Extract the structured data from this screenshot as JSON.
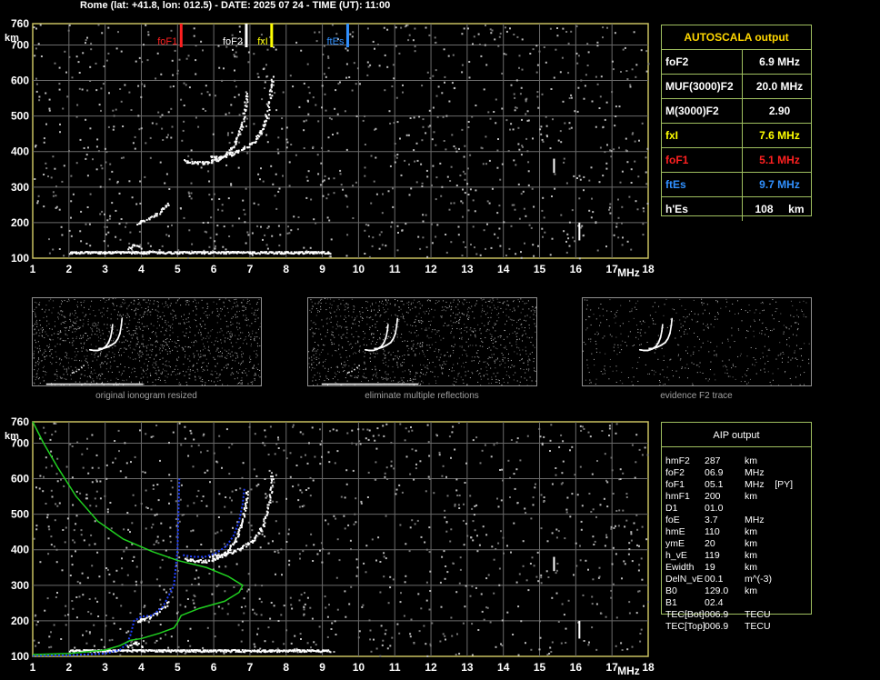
{
  "header": {
    "title": "Rome (lat: +41.8, lon: 012.5) - DATE: 2025 07 24 - TIME (UT): 11:00"
  },
  "chart_data": [
    {
      "type": "scatter",
      "name": "upper-ionogram",
      "ylabel": "km",
      "xlabel": "MHz",
      "xlim": [
        1,
        18
      ],
      "ylim": [
        100,
        760
      ],
      "x_ticks": [
        "1",
        "2",
        "3",
        "4",
        "5",
        "6",
        "7",
        "8",
        "9",
        "10",
        "11",
        "12",
        "13",
        "14",
        "15",
        "16",
        "17",
        "18"
      ],
      "y_ticks": [
        "100",
        "200",
        "300",
        "400",
        "500",
        "600",
        "700",
        "760"
      ],
      "markers": [
        {
          "label": "foF1",
          "freq": 5.1,
          "color": "#ff2020"
        },
        {
          "label": "foF2",
          "freq": 6.9,
          "color": "#ffffff"
        },
        {
          "label": "fxI",
          "freq": 7.6,
          "color": "#ffff00"
        },
        {
          "label": "ftEs",
          "freq": 9.7,
          "color": "#3090ff"
        }
      ],
      "traces": {
        "es_trace": {
          "x": [
            2.0,
            9.2
          ],
          "h": 115
        },
        "e_bump": [
          [
            3.6,
            128
          ],
          [
            3.8,
            140
          ],
          [
            4.0,
            132
          ]
        ],
        "low_f_trace": [
          [
            3.9,
            200
          ],
          [
            4.0,
            205
          ],
          [
            4.2,
            212
          ],
          [
            4.4,
            225
          ],
          [
            4.6,
            240
          ],
          [
            4.75,
            255
          ]
        ],
        "o_trace": [
          [
            5.2,
            375
          ],
          [
            5.5,
            370
          ],
          [
            5.8,
            370
          ],
          [
            6.1,
            380
          ],
          [
            6.4,
            400
          ],
          [
            6.6,
            430
          ],
          [
            6.75,
            470
          ],
          [
            6.85,
            520
          ],
          [
            6.9,
            565
          ]
        ],
        "x_trace": [
          [
            5.9,
            385
          ],
          [
            6.2,
            385
          ],
          [
            6.5,
            395
          ],
          [
            6.8,
            410
          ],
          [
            7.1,
            430
          ],
          [
            7.3,
            460
          ],
          [
            7.45,
            500
          ],
          [
            7.55,
            560
          ],
          [
            7.6,
            610
          ]
        ]
      }
    },
    {
      "type": "line",
      "name": "lower-ionogram",
      "ylabel": "km",
      "xlabel": "MHz",
      "xlim": [
        1,
        18
      ],
      "ylim": [
        100,
        760
      ],
      "x_ticks": [
        "1",
        "2",
        "3",
        "4",
        "5",
        "6",
        "7",
        "8",
        "9",
        "10",
        "11",
        "12",
        "13",
        "14",
        "15",
        "16",
        "17",
        "18"
      ],
      "y_ticks": [
        "100",
        "200",
        "300",
        "400",
        "500",
        "600",
        "700",
        "760"
      ],
      "profile_true_height": [
        [
          1.0,
          760
        ],
        [
          1.3,
          700
        ],
        [
          1.7,
          630
        ],
        [
          2.2,
          550
        ],
        [
          2.8,
          480
        ],
        [
          3.5,
          430
        ],
        [
          4.3,
          395
        ],
        [
          5.0,
          370
        ],
        [
          5.8,
          350
        ],
        [
          6.4,
          325
        ],
        [
          6.8,
          300
        ],
        [
          6.7,
          280
        ],
        [
          6.3,
          255
        ],
        [
          5.6,
          235
        ],
        [
          5.1,
          215
        ],
        [
          5.0,
          195
        ],
        [
          4.9,
          180
        ],
        [
          4.5,
          165
        ],
        [
          4.0,
          150
        ],
        [
          3.7,
          145
        ],
        [
          3.4,
          130
        ],
        [
          3.0,
          118
        ],
        [
          2.0,
          108
        ],
        [
          1.0,
          105
        ]
      ],
      "profile_virtual_height": [
        [
          1.0,
          102
        ],
        [
          2.0,
          103
        ],
        [
          3.0,
          108
        ],
        [
          3.4,
          118
        ],
        [
          3.6,
          135
        ],
        [
          3.7,
          160
        ],
        [
          3.8,
          200
        ],
        [
          4.0,
          212
        ],
        [
          4.3,
          215
        ],
        [
          4.6,
          240
        ],
        [
          4.9,
          300
        ],
        [
          5.0,
          400
        ],
        [
          5.05,
          600
        ]
      ]
    }
  ],
  "autoscala": {
    "title": "AUTOSCALA output",
    "rows": [
      {
        "param": "foF2",
        "value": "6.9 MHz",
        "color": "#ffffff"
      },
      {
        "param": "MUF(3000)F2",
        "value": "20.0 MHz",
        "color": "#ffffff"
      },
      {
        "param": "M(3000)F2",
        "value": "2.90",
        "color": "#ffffff"
      },
      {
        "param": "fxI",
        "value": "7.6 MHz",
        "color": "#ffff00"
      },
      {
        "param": "foF1",
        "value": "5.1 MHz",
        "color": "#ff2020"
      },
      {
        "param": "ftEs",
        "value": "9.7 MHz",
        "color": "#3090ff"
      },
      {
        "param": "h'Es",
        "value": "108     km",
        "color": "#ffffff"
      }
    ]
  },
  "thumbnails": [
    {
      "caption": "original ionogram resized"
    },
    {
      "caption": "eliminate multiple reflections"
    },
    {
      "caption": "evidence F2 trace"
    }
  ],
  "aip": {
    "title": "AIP output",
    "rows": [
      {
        "k": "hmF2",
        "v": "287",
        "u": "km"
      },
      {
        "k": "foF2",
        "v": "06.9",
        "u": "MHz"
      },
      {
        "k": "foF1",
        "v": "05.1",
        "u": "MHz    [PY]"
      },
      {
        "k": "hmF1",
        "v": "200",
        "u": "km"
      },
      {
        "k": "D1",
        "v": "01.0",
        "u": ""
      },
      {
        "k": "foE",
        "v": "3.7",
        "u": "MHz"
      },
      {
        "k": "hmE",
        "v": "110",
        "u": "km"
      },
      {
        "k": "ymE",
        "v": "20",
        "u": "km"
      },
      {
        "k": "h_vE",
        "v": "119",
        "u": "km"
      },
      {
        "k": "Ewidth",
        "v": "19",
        "u": "km"
      },
      {
        "k": "DelN_vE",
        "v": "00.1",
        "u": "m^(-3)"
      },
      {
        "k": "B0",
        "v": "129.0",
        "u": "km"
      },
      {
        "k": "B1",
        "v": "02.4",
        "u": ""
      },
      {
        "k": "TEC[Bot]",
        "v": "006.9",
        "u": "TECU"
      },
      {
        "k": "TEC[Top]",
        "v": "006.9",
        "u": "TECU"
      }
    ]
  }
}
